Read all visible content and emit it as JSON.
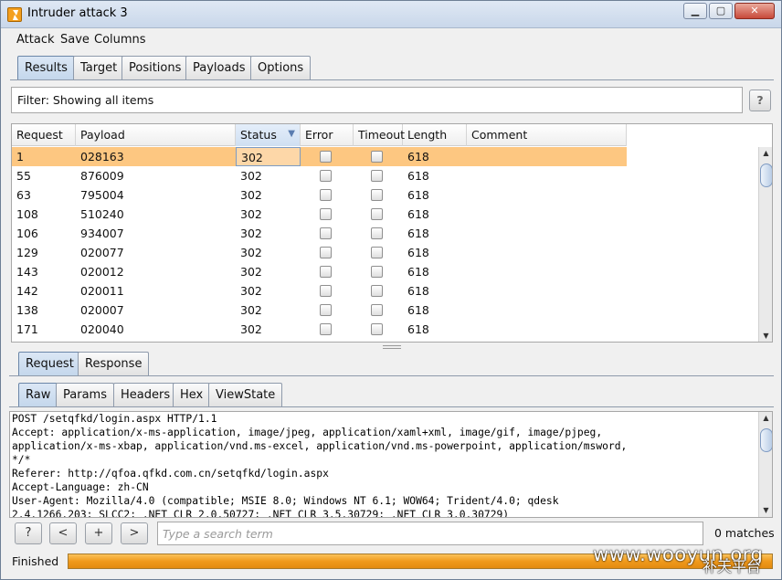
{
  "window": {
    "title": "Intruder attack 3",
    "minimize_glyph": "▁",
    "maximize_glyph": "▢",
    "close_glyph": "✕"
  },
  "menu": [
    "Attack",
    "Save",
    "Columns"
  ],
  "main_tabs": [
    {
      "label": "Results",
      "active": true
    },
    {
      "label": "Target",
      "active": false
    },
    {
      "label": "Positions",
      "active": false
    },
    {
      "label": "Payloads",
      "active": false
    },
    {
      "label": "Options",
      "active": false
    }
  ],
  "filter": {
    "text": "Filter: Showing all items",
    "help_label": "?"
  },
  "results_table": {
    "columns": [
      "Request",
      "Payload",
      "Status",
      "Error",
      "Timeout",
      "Length",
      "Comment"
    ],
    "sorted_column": "Status",
    "sort_glyph": "▼",
    "rows": [
      {
        "request": "1",
        "payload": "028163",
        "status": "302",
        "error": false,
        "timeout": false,
        "length": "618",
        "comment": "",
        "selected": true
      },
      {
        "request": "55",
        "payload": "876009",
        "status": "302",
        "error": false,
        "timeout": false,
        "length": "618",
        "comment": ""
      },
      {
        "request": "63",
        "payload": "795004",
        "status": "302",
        "error": false,
        "timeout": false,
        "length": "618",
        "comment": ""
      },
      {
        "request": "108",
        "payload": "510240",
        "status": "302",
        "error": false,
        "timeout": false,
        "length": "618",
        "comment": ""
      },
      {
        "request": "106",
        "payload": "934007",
        "status": "302",
        "error": false,
        "timeout": false,
        "length": "618",
        "comment": ""
      },
      {
        "request": "129",
        "payload": "020077",
        "status": "302",
        "error": false,
        "timeout": false,
        "length": "618",
        "comment": ""
      },
      {
        "request": "143",
        "payload": "020012",
        "status": "302",
        "error": false,
        "timeout": false,
        "length": "618",
        "comment": ""
      },
      {
        "request": "142",
        "payload": "020011",
        "status": "302",
        "error": false,
        "timeout": false,
        "length": "618",
        "comment": ""
      },
      {
        "request": "138",
        "payload": "020007",
        "status": "302",
        "error": false,
        "timeout": false,
        "length": "618",
        "comment": ""
      },
      {
        "request": "171",
        "payload": "020040",
        "status": "302",
        "error": false,
        "timeout": false,
        "length": "618",
        "comment": ""
      }
    ]
  },
  "detail_tabs": [
    {
      "label": "Request",
      "active": true
    },
    {
      "label": "Response",
      "active": false
    }
  ],
  "view_tabs": [
    {
      "label": "Raw",
      "active": true
    },
    {
      "label": "Params",
      "active": false
    },
    {
      "label": "Headers",
      "active": false
    },
    {
      "label": "Hex",
      "active": false
    },
    {
      "label": "ViewState",
      "active": false
    }
  ],
  "request_lines": [
    "POST /setqfkd/login.aspx HTTP/1.1",
    "Accept: application/x-ms-application, image/jpeg, application/xaml+xml, image/gif, image/pjpeg,",
    "application/x-ms-xbap, application/vnd.ms-excel, application/vnd.ms-powerpoint, application/msword,",
    "*/*",
    "Referer: http://qfoa.qfkd.com.cn/setqfkd/login.aspx",
    "Accept-Language: zh-CN",
    "User-Agent: Mozilla/4.0 (compatible; MSIE 8.0; Windows NT 6.1; WOW64; Trident/4.0; qdesk",
    "2.4.1266.203; SLCC2; .NET CLR 2.0.50727; .NET CLR 3.5.30729; .NET CLR 3.0.30729)"
  ],
  "search": {
    "help_label": "?",
    "prev_label": "<",
    "add_label": "+",
    "next_label": ">",
    "placeholder": "Type a search term",
    "matches": "0 matches"
  },
  "status": {
    "text": "Finished",
    "progress_percent": 100
  },
  "watermark": {
    "line1": "www.wooyun.org",
    "line2": "补天平台"
  },
  "colors": {
    "selected_row": "#fdc781",
    "progress": "#f09a1c",
    "tab_active": "#c4d7ec"
  }
}
